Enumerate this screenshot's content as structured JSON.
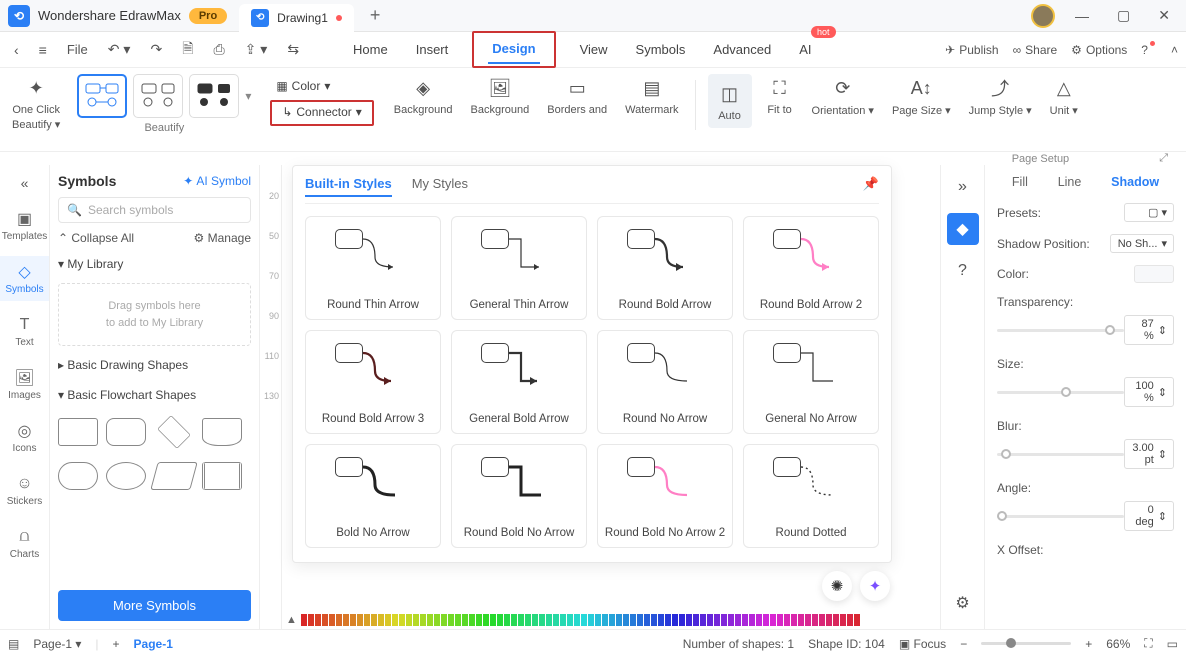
{
  "titlebar": {
    "app_name": "Wondershare EdrawMax",
    "pro_badge": "Pro",
    "document_name": "Drawing1",
    "new_tab_glyph": "+"
  },
  "window_controls": {
    "minimize": "—",
    "maximize": "▢",
    "close": "✕"
  },
  "menubar": {
    "file": "File",
    "tabs": [
      "Home",
      "Insert",
      "Design",
      "View",
      "Symbols",
      "Advanced",
      "AI"
    ],
    "active_tab": "Design",
    "ai_hot": "hot",
    "publish": "Publish",
    "share": "Share",
    "options": "Options"
  },
  "ribbon": {
    "one_click": "One Click",
    "beautify": "Beautify",
    "beautify_caption": "Beautify",
    "color": "Color",
    "connector": "Connector",
    "background1": "Background",
    "background2": "Background",
    "borders": "Borders and",
    "watermark": "Watermark",
    "auto": "Auto",
    "fit_to": "Fit to",
    "orientation": "Orientation",
    "page_size": "Page Size",
    "jump_style": "Jump Style",
    "unit": "Unit",
    "page_setup": "Page Setup"
  },
  "left_rail": {
    "templates": "Templates",
    "symbols": "Symbols",
    "text": "Text",
    "images": "Images",
    "icons": "Icons",
    "stickers": "Stickers",
    "charts": "Charts"
  },
  "symbols_panel": {
    "title": "Symbols",
    "ai_symbol": "AI Symbol",
    "search_placeholder": "Search symbols",
    "collapse_all": "Collapse All",
    "manage": "Manage",
    "my_library": "My Library",
    "drop_line1": "Drag symbols here",
    "drop_line2": "to add to My Library",
    "basic_drawing": "Basic Drawing Shapes",
    "basic_flowchart": "Basic Flowchart Shapes",
    "more_symbols": "More Symbols"
  },
  "ruler_v": [
    "20",
    "50",
    "70",
    "90",
    "110",
    "130"
  ],
  "styles_popup": {
    "tab_builtin": "Built-in Styles",
    "tab_my": "My Styles",
    "items": [
      "Round Thin Arrow",
      "General Thin Arrow",
      "Round Bold Arrow",
      "Round Bold Arrow 2",
      "Round Bold Arrow 3",
      "General Bold Arrow",
      "Round No Arrow",
      "General No Arrow",
      "Bold No Arrow",
      "Round Bold No Arrow",
      "Round Bold No Arrow 2",
      "Round Dotted"
    ]
  },
  "color_strip_lead": "▲",
  "right_panel": {
    "tabs": {
      "fill": "Fill",
      "line": "Line",
      "shadow": "Shadow"
    },
    "presets_label": "Presets:",
    "shadow_pos_label": "Shadow Position:",
    "shadow_pos_value": "No Sh...",
    "color_label": "Color:",
    "transparency_label": "Transparency:",
    "transparency_value": "87 %",
    "size_label": "Size:",
    "size_value": "100 %",
    "blur_label": "Blur:",
    "blur_value": "3.00 pt",
    "angle_label": "Angle:",
    "angle_value": "0 deg",
    "xoffset_label": "X Offset:"
  },
  "statusbar": {
    "page_dropdown": "Page-1",
    "page_tab": "Page-1",
    "num_shapes": "Number of shapes: 1",
    "shape_id": "Shape ID: 104",
    "focus": "Focus",
    "zoom": "66%"
  }
}
